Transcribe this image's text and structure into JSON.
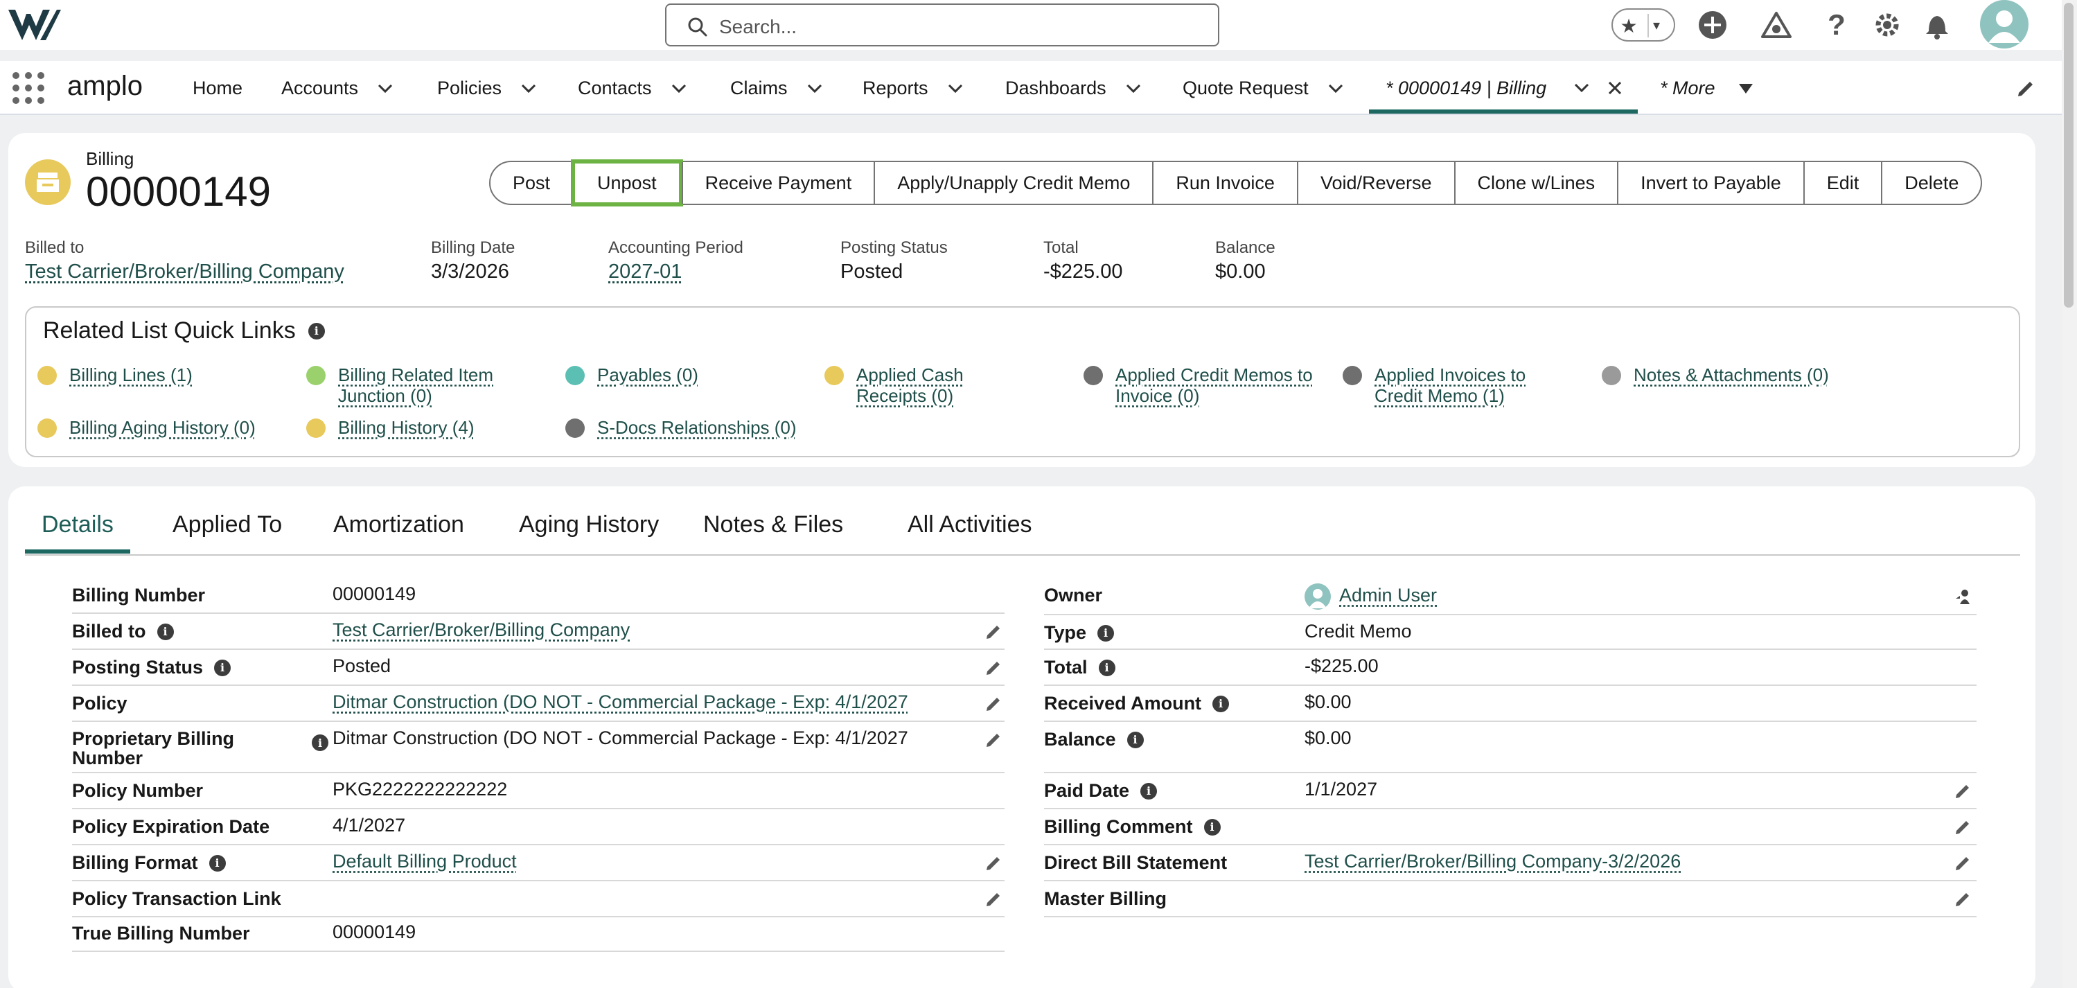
{
  "header": {
    "search_placeholder": "Search...",
    "icons": [
      "favorites-star-icon",
      "add-icon",
      "trailhead-icon",
      "help-icon",
      "setup-gear-icon",
      "notification-bell-icon",
      "user-avatar"
    ]
  },
  "nav": {
    "app_name": "amplo",
    "items": [
      {
        "label": "Home",
        "has_menu": false
      },
      {
        "label": "Accounts",
        "has_menu": true
      },
      {
        "label": "Policies",
        "has_menu": true
      },
      {
        "label": "Contacts",
        "has_menu": true
      },
      {
        "label": "Claims",
        "has_menu": true
      },
      {
        "label": "Reports",
        "has_menu": true
      },
      {
        "label": "Dashboards",
        "has_menu": true
      },
      {
        "label": "Quote Request",
        "has_menu": true
      }
    ],
    "active_tab": "* 00000149 | Billing",
    "more": "* More"
  },
  "record": {
    "object_type": "Billing",
    "name": "00000149",
    "actions": [
      "Post",
      "Unpost",
      "Receive Payment",
      "Apply/Unapply Credit Memo",
      "Run Invoice",
      "Void/Reverse",
      "Clone w/Lines",
      "Invert to Payable",
      "Edit",
      "Delete"
    ],
    "highlighted_action": "Unpost",
    "highlights": {
      "billed_to_label": "Billed to",
      "billed_to_value": "Test Carrier/Broker/Billing Company",
      "billing_date_label": "Billing Date",
      "billing_date_value": "3/3/2026",
      "accounting_period_label": "Accounting Period",
      "accounting_period_value": "2027-01",
      "posting_status_label": "Posting Status",
      "posting_status_value": "Posted",
      "total_label": "Total",
      "total_value": "-$225.00",
      "balance_label": "Balance",
      "balance_value": "$0.00"
    }
  },
  "quick_links": {
    "title": "Related List Quick Links",
    "items": [
      {
        "label": "Billing Lines (1)",
        "color": "#e8c95c"
      },
      {
        "label": "Billing Related Item Junction (0)",
        "line1": "Billing Related Item",
        "line2": "Junction (0)",
        "color": "#9ad16c"
      },
      {
        "label": "Payables (0)",
        "color": "#5bbfb4"
      },
      {
        "label": "Applied Cash Receipts (0)",
        "line1": "Applied Cash",
        "line2": "Receipts (0)",
        "color": "#e8c95c"
      },
      {
        "label": "Applied Credit Memos to Invoice (0)",
        "line1": "Applied Credit Memos to",
        "line2": "Invoice (0)",
        "color": "#6f6f6f"
      },
      {
        "label": "Applied Invoices to Credit Memo (1)",
        "line1": "Applied Invoices to",
        "line2": "Credit Memo (1)",
        "color": "#6f6f6f"
      },
      {
        "label": "Notes & Attachments (0)",
        "color": "#9a9a9a"
      },
      {
        "label": "Billing Aging History (0)",
        "color": "#e8c95c"
      },
      {
        "label": "Billing History (4)",
        "color": "#e8c95c"
      },
      {
        "label": "S-Docs Relationships (0)",
        "color": "#6f6f6f"
      }
    ]
  },
  "tabs": [
    "Details",
    "Applied To",
    "Amortization",
    "Aging History",
    "Notes & Files",
    "All Activities"
  ],
  "details_left": [
    {
      "label": "Billing Number",
      "value": "00000149",
      "info": false,
      "link": false,
      "editable": false
    },
    {
      "label": "Billed to",
      "value": "Test Carrier/Broker/Billing Company",
      "info": true,
      "link": true,
      "editable": true
    },
    {
      "label": "Posting Status",
      "value": "Posted",
      "info": true,
      "link": false,
      "editable": true
    },
    {
      "label": "Policy",
      "value": "Ditmar Construction (DO NOT - Commercial Package - Exp: 4/1/2027",
      "info": false,
      "link": true,
      "editable": true
    },
    {
      "label": "Proprietary Billing Number",
      "line1": "Proprietary Billing",
      "line2": "Number",
      "value": "Ditmar Construction (DO NOT - Commercial Package - Exp: 4/1/2027",
      "info": true,
      "link": false,
      "editable": true
    },
    {
      "label": "Policy Number",
      "value": "PKG2222222222222",
      "info": false,
      "link": false,
      "editable": false
    },
    {
      "label": "Policy Expiration Date",
      "value": "4/1/2027",
      "info": false,
      "link": false,
      "editable": false
    },
    {
      "label": "Billing Format",
      "value": "Default Billing Product",
      "info": true,
      "link": true,
      "editable": true
    },
    {
      "label": "Policy Transaction Link",
      "value": "",
      "info": false,
      "link": false,
      "editable": true
    },
    {
      "label": "True Billing Number",
      "value": "00000149",
      "info": false,
      "link": false,
      "editable": false
    }
  ],
  "details_right": [
    {
      "label": "Owner",
      "value": "Admin User",
      "info": false,
      "link": true,
      "editable": false
    },
    {
      "label": "Type",
      "value": "Credit Memo",
      "info": true,
      "link": false,
      "editable": false
    },
    {
      "label": "Total",
      "value": "-$225.00",
      "info": true,
      "link": false,
      "editable": false
    },
    {
      "label": "Received Amount",
      "value": "$0.00",
      "info": true,
      "link": false,
      "editable": false
    },
    {
      "label": "Balance",
      "value": "$0.00",
      "info": true,
      "link": false,
      "editable": false
    },
    {
      "label": "Paid Date",
      "value": "1/1/2027",
      "info": true,
      "link": false,
      "editable": true
    },
    {
      "label": "Billing Comment",
      "value": "",
      "info": true,
      "link": false,
      "editable": true
    },
    {
      "label": "Direct Bill Statement",
      "value": "Test Carrier/Broker/Billing Company-3/2/2026",
      "info": false,
      "link": true,
      "editable": true
    },
    {
      "label": "Master Billing",
      "value": "",
      "info": false,
      "link": false,
      "editable": true
    }
  ]
}
